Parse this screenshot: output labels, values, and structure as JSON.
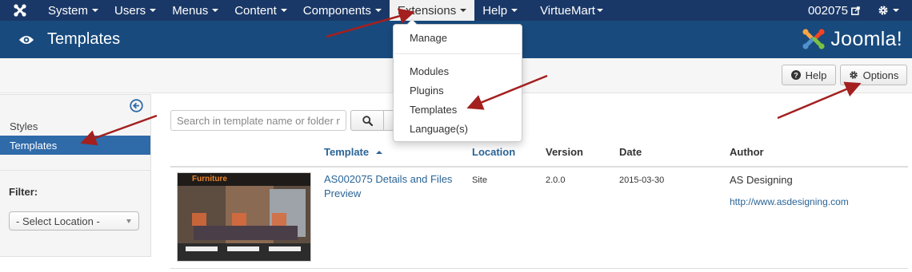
{
  "topnav": {
    "logo_icon": "joomla-logo-icon",
    "menu": [
      {
        "label": "System"
      },
      {
        "label": "Users"
      },
      {
        "label": "Menus"
      },
      {
        "label": "Content"
      },
      {
        "label": "Components"
      },
      {
        "label": "Extensions"
      },
      {
        "label": "Help"
      },
      {
        "label": "VirtueMart"
      }
    ],
    "active_menu": "Extensions",
    "user_label": "002075",
    "user_icon": "external-link-icon",
    "settings_icon": "gear-icon"
  },
  "header": {
    "icon": "eye-icon",
    "title": "Templates",
    "brand_text": "Joomla!"
  },
  "toolbar": {
    "help_label": "Help",
    "help_icon": "question-circle-icon",
    "options_label": "Options",
    "options_icon": "gear-icon"
  },
  "extensions_menu": {
    "items": [
      "Manage",
      "Modules",
      "Plugins",
      "Templates",
      "Language(s)"
    ]
  },
  "sidebar": {
    "collapse_icon": "arrow-left-circle-icon",
    "items": [
      {
        "label": "Styles",
        "active": false
      },
      {
        "label": "Templates",
        "active": true
      }
    ],
    "filter_label": "Filter:",
    "location_select": "- Select Location -"
  },
  "search": {
    "placeholder": "Search in template name or folder n",
    "icon": "search-icon"
  },
  "table": {
    "headers": {
      "template": "Template",
      "location": "Location",
      "version": "Version",
      "date": "Date",
      "author": "Author"
    },
    "sort_icon": "caret-up-icon",
    "rows": [
      {
        "thumbnail_title": "Furniture",
        "name_line1": "AS002075 Details and Files",
        "name_line2": "Preview",
        "location": "Site",
        "version": "2.0.0",
        "date": "2015-03-30",
        "author": "AS Designing",
        "author_url": "http://www.asdesigning.com"
      }
    ]
  },
  "colors": {
    "topnav_bg": "#1a3867",
    "header_bg": "#184a7d",
    "active_item": "#2f6aa9",
    "link": "#2a6496",
    "annotation_arrow": "#a3201f"
  }
}
